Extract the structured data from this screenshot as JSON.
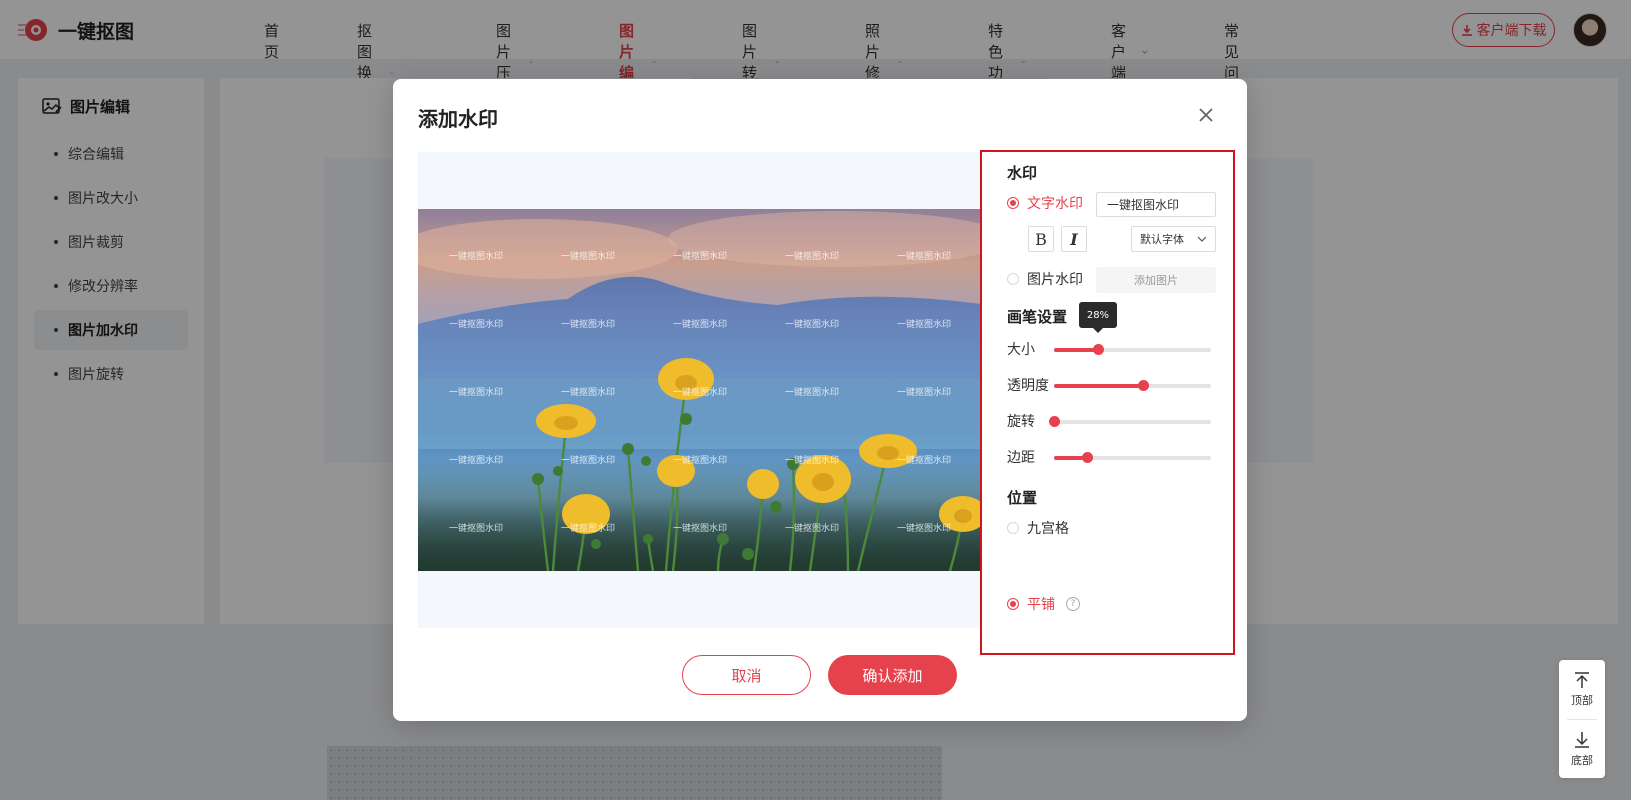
{
  "app": {
    "name": "一键抠图"
  },
  "nav": {
    "items": [
      {
        "label": "首页",
        "has_dropdown": false,
        "active": false
      },
      {
        "label": "抠图换背景",
        "has_dropdown": true,
        "active": false
      },
      {
        "label": "图片压缩",
        "has_dropdown": true,
        "active": false
      },
      {
        "label": "图片编辑",
        "has_dropdown": true,
        "active": true
      },
      {
        "label": "图片转换",
        "has_dropdown": true,
        "active": false
      },
      {
        "label": "照片修复",
        "has_dropdown": true,
        "active": false
      },
      {
        "label": "特色功能",
        "has_dropdown": true,
        "active": false
      },
      {
        "label": "客户端",
        "has_dropdown": true,
        "active": false
      },
      {
        "label": "常见问题",
        "has_dropdown": false,
        "active": false
      }
    ],
    "download_label": "客户端下载"
  },
  "sidebar": {
    "title": "图片编辑",
    "items": [
      {
        "label": "综合编辑",
        "active": false
      },
      {
        "label": "图片改大小",
        "active": false
      },
      {
        "label": "图片裁剪",
        "active": false
      },
      {
        "label": "修改分辨率",
        "active": false
      },
      {
        "label": "图片加水印",
        "active": true
      },
      {
        "label": "图片旋转",
        "active": false
      }
    ]
  },
  "float_tools": {
    "top_label": "顶部",
    "bottom_label": "底部"
  },
  "modal": {
    "title": "添加水印",
    "preview": {
      "watermark_text": "一键抠图水印"
    },
    "watermark": {
      "section_title": "水印",
      "text_option_label": "文字水印",
      "text_value": "一键抠图水印",
      "bold_label": "B",
      "italic_label": "I",
      "font_value": "默认字体",
      "image_option_label": "图片水印",
      "add_image_label": "添加图片",
      "selected": "text"
    },
    "brush": {
      "section_title": "画笔设置",
      "sliders": [
        {
          "label": "大小",
          "value": 0.28,
          "tooltip": "28%"
        },
        {
          "label": "透明度",
          "value": 0.57
        },
        {
          "label": "旋转",
          "value": 0.0
        },
        {
          "label": "边距",
          "value": 0.21
        }
      ]
    },
    "position": {
      "section_title": "位置",
      "grid_label": "九宫格",
      "tile_label": "平铺",
      "help_label": "?",
      "selected": "tile"
    },
    "buttons": {
      "cancel": "取消",
      "confirm": "确认添加"
    }
  },
  "colors": {
    "accent": "#e6424d",
    "highlight_border": "#d0151e"
  }
}
